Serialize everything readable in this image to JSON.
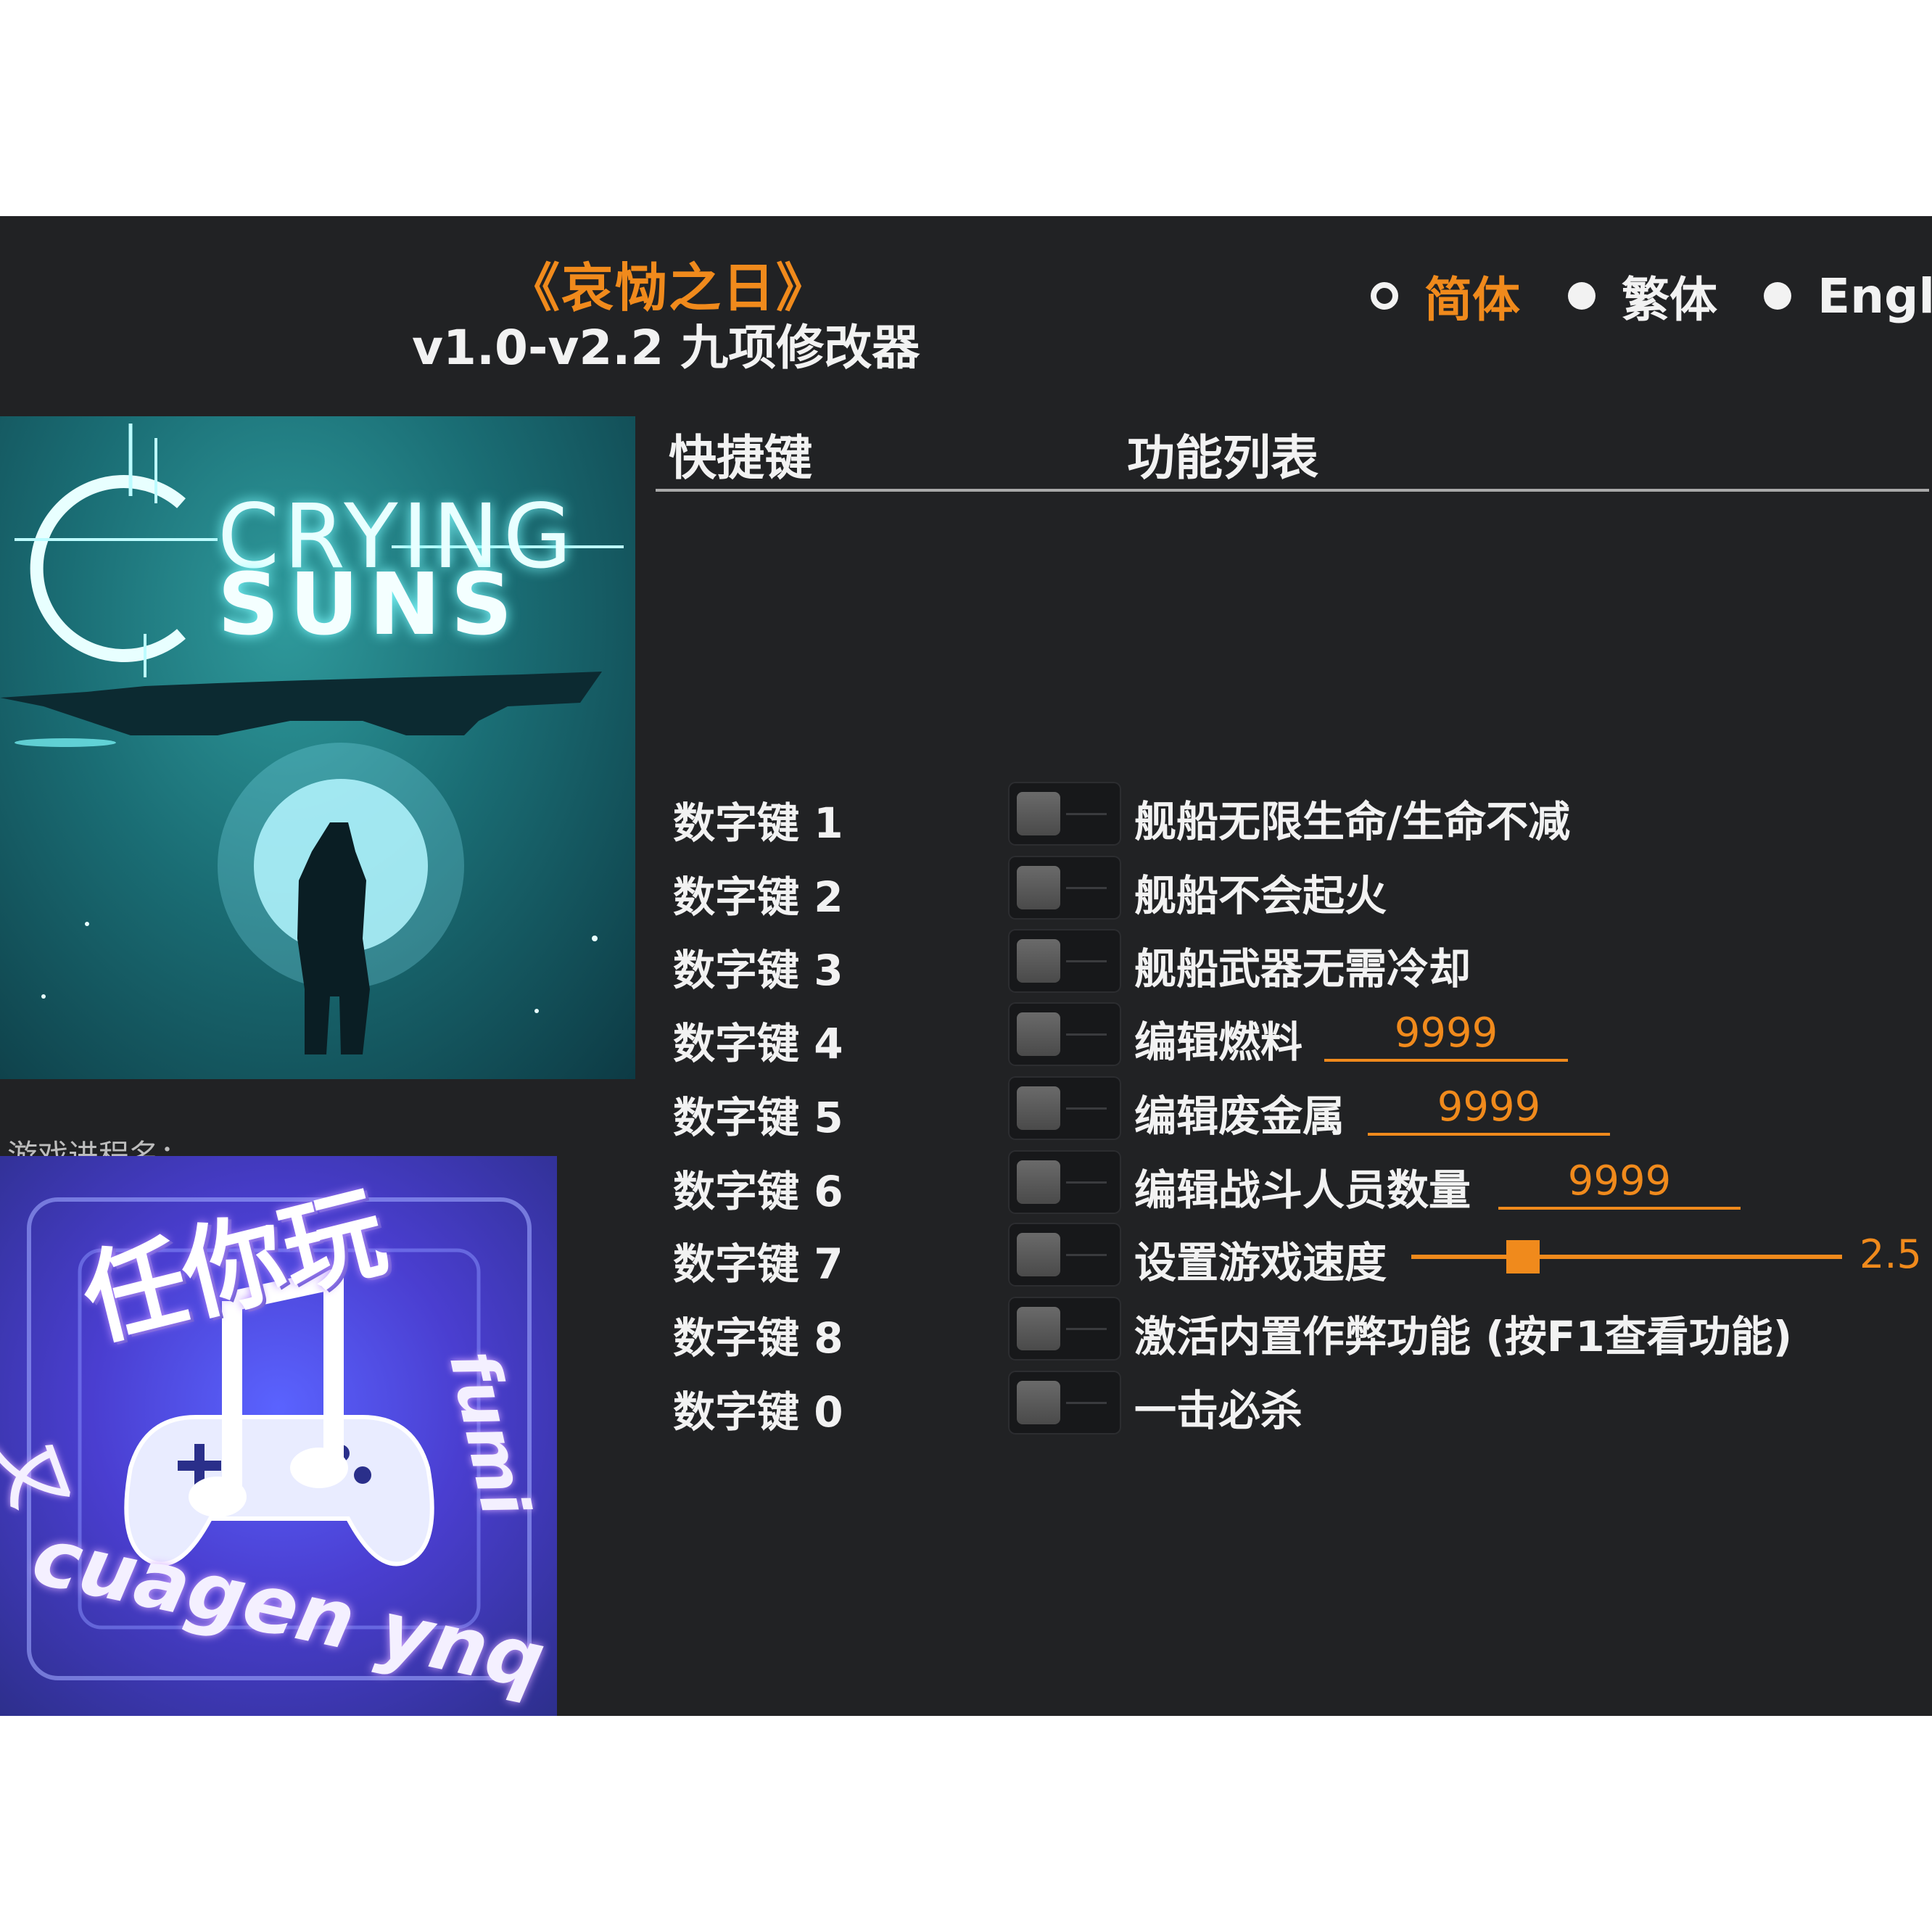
{
  "header": {
    "title": "《哀恸之日》",
    "subtitle": "v1.0-v2.2 九项修改器"
  },
  "languages": [
    {
      "label": "简体",
      "selected": true
    },
    {
      "label": "繁体",
      "selected": false
    },
    {
      "label": "Engl",
      "selected": false
    }
  ],
  "cover": {
    "line1": "CRYING",
    "line2": "SUNS"
  },
  "process_label": "游戏进程名：",
  "logo": {
    "top_text": "任你玩",
    "bottom_text": "cuagen ynq",
    "side_left": "又",
    "side_right": "fumi"
  },
  "table": {
    "col_hotkey": "快捷键",
    "col_function": "功能列表",
    "rows": [
      {
        "key": "数字键 1",
        "label": "舰船无限生命/生命不减",
        "enabled": false
      },
      {
        "key": "数字键 2",
        "label": "舰船不会起火",
        "enabled": false
      },
      {
        "key": "数字键 3",
        "label": "舰船武器无需冷却",
        "enabled": false
      },
      {
        "key": "数字键 4",
        "label": "编辑燃料",
        "value": "9999",
        "enabled": false
      },
      {
        "key": "数字键 5",
        "label": "编辑废金属",
        "value": "9999",
        "enabled": false
      },
      {
        "key": "数字键 6",
        "label": "编辑战斗人员数量",
        "value": "9999",
        "enabled": false
      },
      {
        "key": "数字键 7",
        "label": "设置游戏速度",
        "slider_value": "2.5",
        "slider_fraction": 0.26,
        "enabled": false
      },
      {
        "key": "数字键 8",
        "label": "激活内置作弊功能 (按F1查看功能)",
        "enabled": false
      },
      {
        "key": "数字键 0",
        "label": "一击必杀",
        "enabled": false
      }
    ]
  },
  "colors": {
    "background": "#212224",
    "accent": "#f08a1c",
    "text": "#f2f2f2"
  }
}
